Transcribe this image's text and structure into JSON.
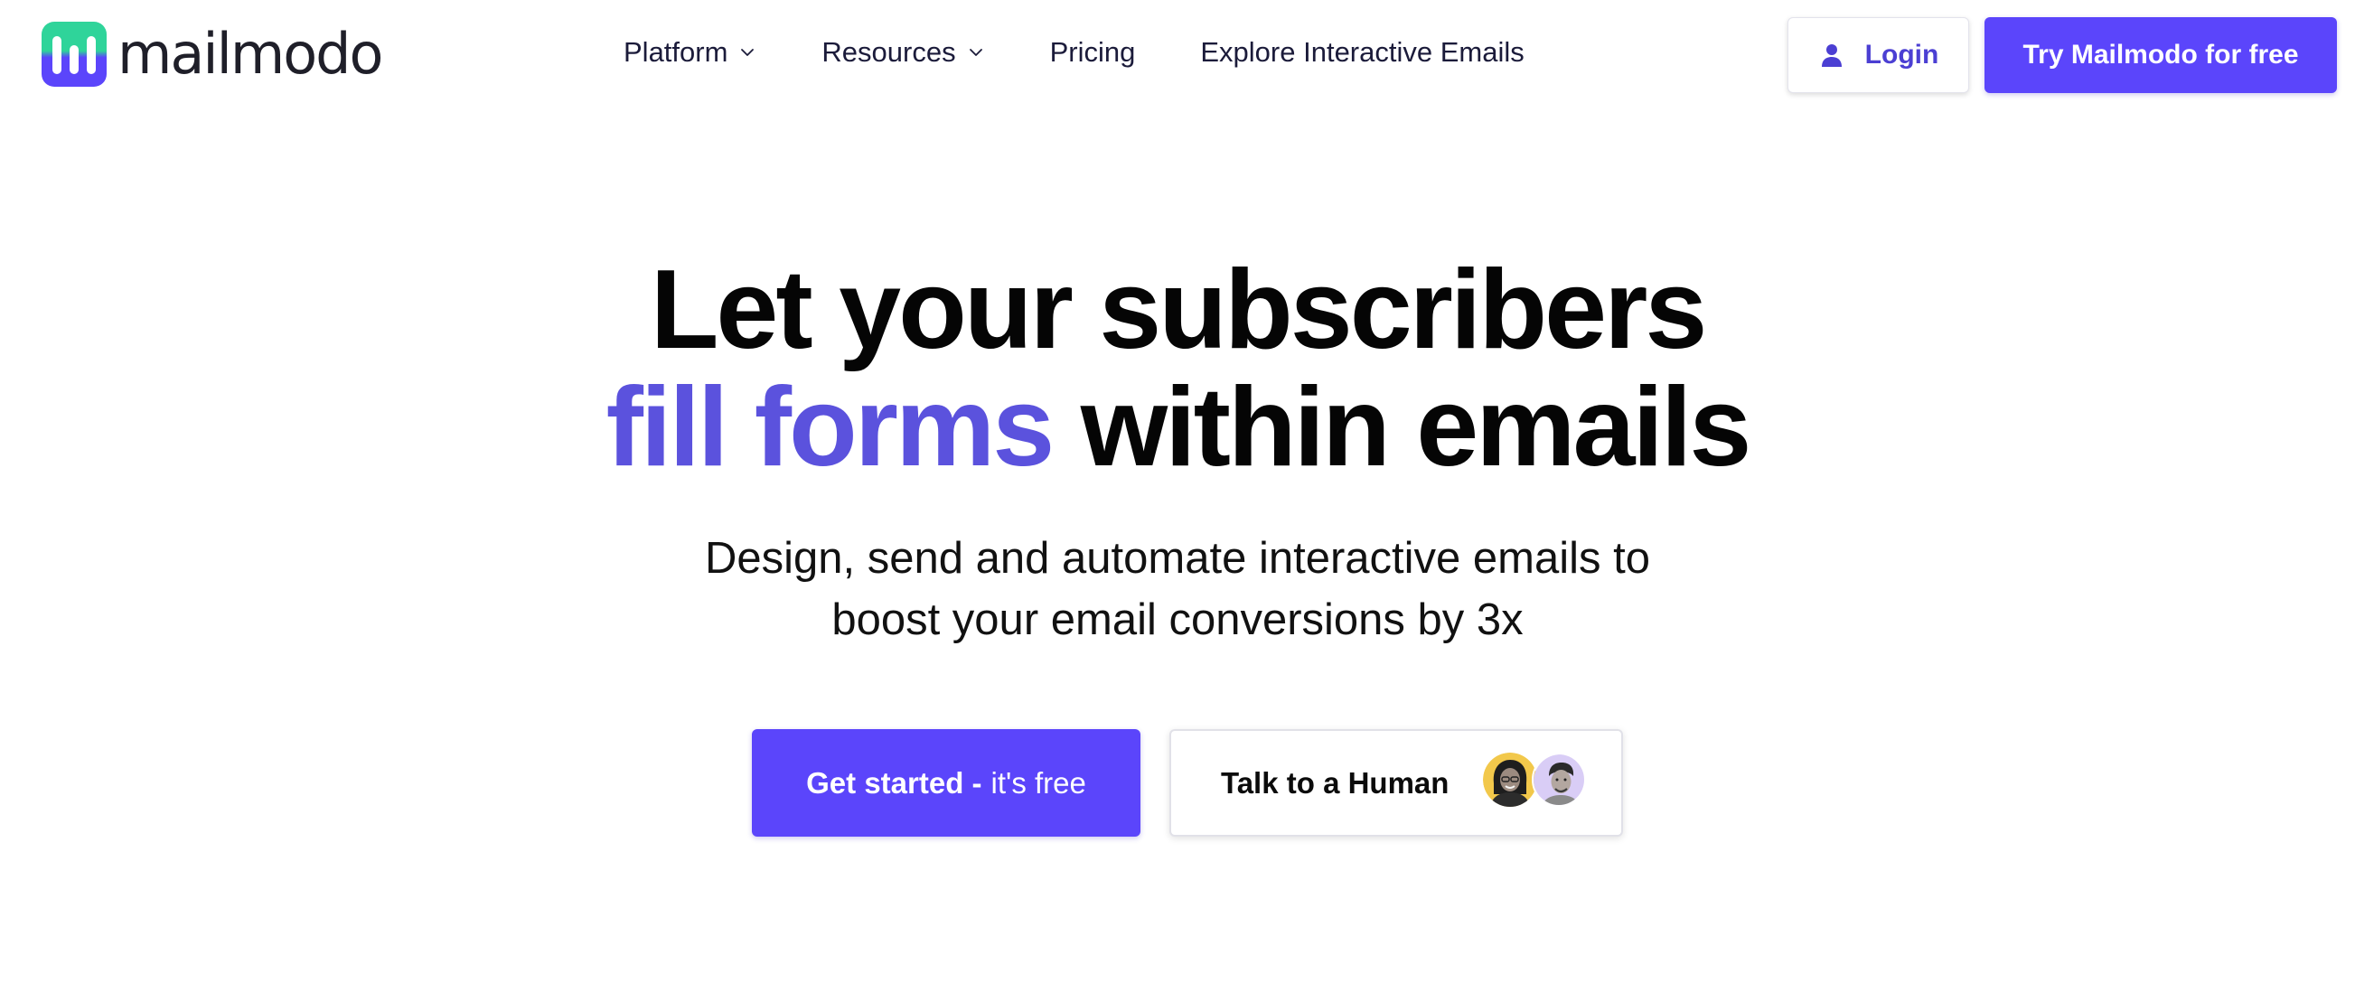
{
  "brand": {
    "name": "mailmodo",
    "colors": {
      "accent": "#5b45fb",
      "accent_text": "#5b52dd",
      "logo_green": "#2fd49a",
      "logo_purple": "#5b45fb"
    }
  },
  "nav": {
    "items": [
      {
        "label": "Platform",
        "has_dropdown": true
      },
      {
        "label": "Resources",
        "has_dropdown": true
      },
      {
        "label": "Pricing",
        "has_dropdown": false
      },
      {
        "label": "Explore Interactive Emails",
        "has_dropdown": false
      }
    ],
    "login_label": "Login",
    "login_icon": "user-icon",
    "try_label": "Try Mailmodo for free"
  },
  "hero": {
    "title_line1": "Let your subscribers",
    "title_accent": "fill forms",
    "title_rest": "within emails",
    "subtitle_line1": "Design, send and automate interactive emails to",
    "subtitle_line2": "boost your email conversions by 3x"
  },
  "cta": {
    "primary_strong": "Get started -",
    "primary_light": "it's free",
    "secondary_label": "Talk to a Human",
    "avatars": [
      "avatar-woman",
      "avatar-man"
    ]
  }
}
